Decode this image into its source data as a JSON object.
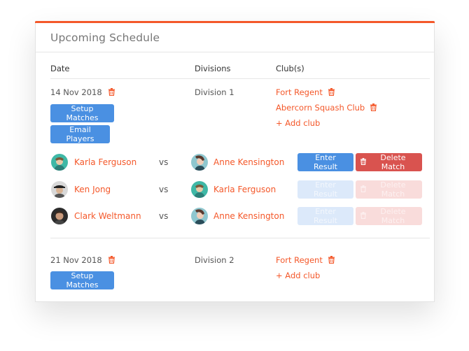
{
  "colors": {
    "accent": "#f4582a",
    "primary_button": "#4a90e2",
    "danger_button": "#d9534f"
  },
  "card": {
    "title": "Upcoming Schedule"
  },
  "table": {
    "headers": {
      "date": "Date",
      "divisions": "Divisions",
      "clubs": "Club(s)"
    }
  },
  "schedules": [
    {
      "date": "14 Nov 2018",
      "division": "Division 1",
      "clubs": [
        "Fort Regent",
        "Abercorn Squash Club"
      ],
      "add_club_label": "+ Add club",
      "buttons": {
        "setup": "Setup Matches",
        "email": "Email Players"
      },
      "matches": [
        {
          "player1": "Karla Ferguson",
          "vs": "vs",
          "player2": "Anne Kensington",
          "enter_result": "Enter Result",
          "delete_match": "Delete Match",
          "enabled": true
        },
        {
          "player1": "Ken Jong",
          "vs": "vs",
          "player2": "Karla Ferguson",
          "enter_result": "Enter Result",
          "delete_match": "Delete Match",
          "enabled": false
        },
        {
          "player1": "Clark Weltmann",
          "vs": "vs",
          "player2": "Anne Kensington",
          "enter_result": "Enter Result",
          "delete_match": "Delete Match",
          "enabled": false
        }
      ]
    },
    {
      "date": "21 Nov 2018",
      "division": "Division 2",
      "clubs": [
        "Fort Regent"
      ],
      "add_club_label": "+ Add club",
      "buttons": {
        "setup": "Setup Matches"
      }
    }
  ],
  "icons": {
    "delete": "trash-icon",
    "avatar": "avatar-image"
  }
}
